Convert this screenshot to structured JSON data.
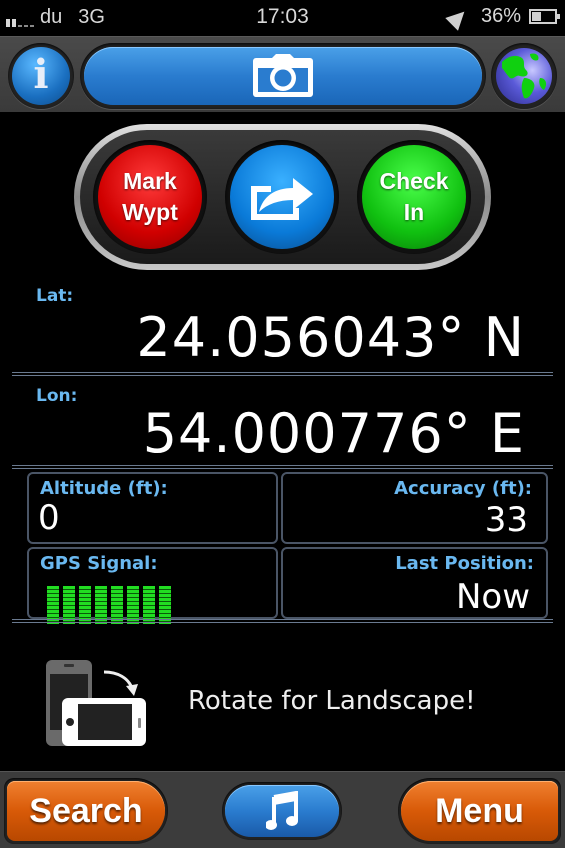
{
  "status_bar": {
    "signal_bars_on": 2,
    "signal_bars_total": 5,
    "carrier": "du",
    "network": "3G",
    "time": "17:03",
    "location_icon": "location-arrow-icon",
    "battery_percent_label": "36%",
    "battery_level": 0.36
  },
  "top_bar": {
    "info_button": {
      "icon": "info-icon",
      "glyph": "i"
    },
    "camera_button": {
      "icon": "camera-icon"
    },
    "globe_button": {
      "icon": "globe-icon"
    }
  },
  "actions": {
    "mark_waypoint": {
      "line1": "Mark",
      "line2": "Wypt",
      "color": "#d00000"
    },
    "share": {
      "icon": "share-arrow-icon",
      "color": "#0a7ad8"
    },
    "check_in": {
      "line1": "Check",
      "line2": "In",
      "color": "#10c010"
    }
  },
  "coordinates": {
    "lat_label": "Lat:",
    "lat_value": "24.056043° N",
    "lon_label": "Lon:",
    "lon_value": "54.000776° E"
  },
  "panels": {
    "altitude": {
      "label": "Altitude (ft):",
      "value": "0"
    },
    "accuracy": {
      "label": "Accuracy (ft):",
      "value": "33"
    },
    "gps_signal": {
      "label": "GPS Signal:",
      "bars": 8,
      "bars_max": 8,
      "color": "#22dd22"
    },
    "last_position": {
      "label": "Last Position:",
      "value": "Now"
    }
  },
  "rotate_hint": {
    "icon": "rotate-device-icon",
    "text": "Rotate for Landscape!"
  },
  "bottom_bar": {
    "search_label": "Search",
    "music_icon": "music-note-icon",
    "menu_label": "Menu"
  },
  "colors": {
    "label_blue": "#6ab8f0",
    "button_blue": "#2a7ccf",
    "button_orange": "#d85a08"
  }
}
